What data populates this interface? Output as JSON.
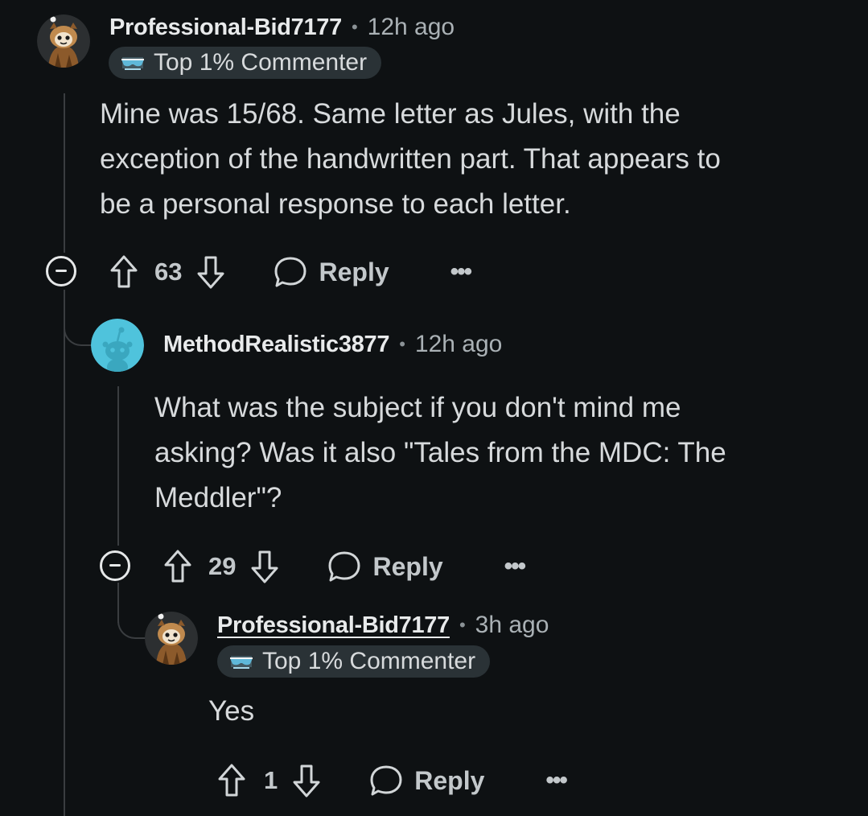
{
  "comments": [
    {
      "username": "Professional-Bid7177",
      "time": "12h ago",
      "badge": "Top 1% Commenter",
      "body_lines": [
        "Mine was 15/68. Same letter as Jules, with the",
        "exception of the handwritten part. That appears to",
        "be a personal response to each letter."
      ],
      "votes": "63",
      "reply_label": "Reply",
      "more_label": "•••"
    },
    {
      "username": "MethodRealistic3877",
      "time": "12h ago",
      "body_lines": [
        "What was the subject if you don't mind me",
        "asking? Was it also \"Tales from the MDC: The",
        "Meddler\"?"
      ],
      "votes": "29",
      "reply_label": "Reply",
      "more_label": "•••"
    },
    {
      "username": "Professional-Bid7177",
      "time": "3h ago",
      "badge": "Top 1% Commenter",
      "body_lines": [
        "Yes"
      ],
      "votes": "1",
      "reply_label": "Reply",
      "more_label": "•••"
    }
  ],
  "separator": "•",
  "icons": {
    "upvote": "arrow-up-outline-icon",
    "downvote": "arrow-down-outline-icon",
    "reply": "speech-bubble-icon",
    "collapse": "minus-circle-icon",
    "badge": "sunglasses-badge-icon"
  },
  "colors": {
    "background": "#0e1113",
    "text": "#d7dadc",
    "badge_bg": "#2a3236",
    "default_avatar": "#4fc3dc"
  }
}
